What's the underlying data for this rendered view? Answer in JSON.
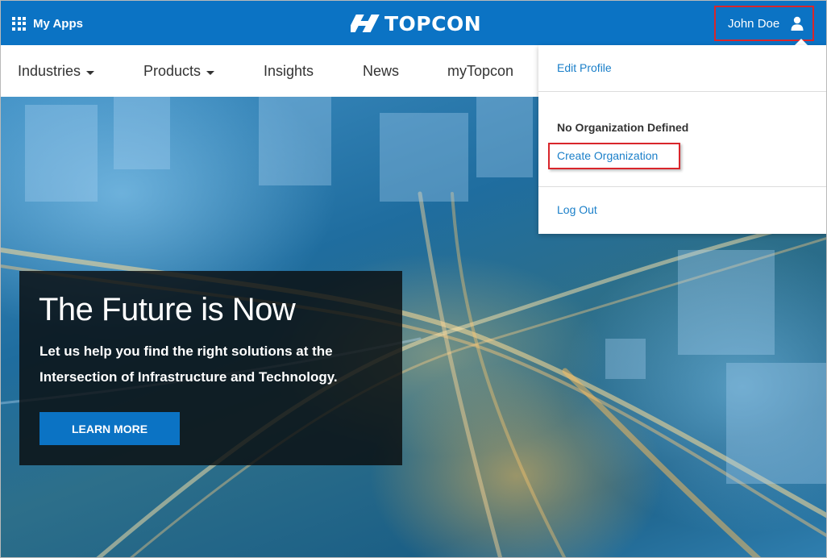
{
  "topbar": {
    "myapps_label": "My Apps",
    "logo_text": "TOPCON",
    "user_name": "John Doe"
  },
  "nav": {
    "items": [
      {
        "label": "Industries",
        "has_caret": true
      },
      {
        "label": "Products",
        "has_caret": true
      },
      {
        "label": "Insights",
        "has_caret": false
      },
      {
        "label": "News",
        "has_caret": false
      },
      {
        "label": "myTopcon",
        "has_caret": false
      }
    ]
  },
  "hero": {
    "title": "The Future is Now",
    "subtitle": "Let us help you find the right solutions at the Intersection of Infrastructure and Technology.",
    "cta_label": "LEARN MORE"
  },
  "user_menu": {
    "edit_profile": "Edit Profile",
    "org_heading": "No Organization Defined",
    "create_org": "Create Organization",
    "log_out": "Log Out"
  },
  "colors": {
    "brand_blue": "#0b73c4",
    "link_blue": "#1a7fc9",
    "highlight_red": "#d9262b"
  },
  "icons": {
    "apps": "grid-icon",
    "logo": "topcon-logo-icon",
    "user": "user-icon"
  }
}
